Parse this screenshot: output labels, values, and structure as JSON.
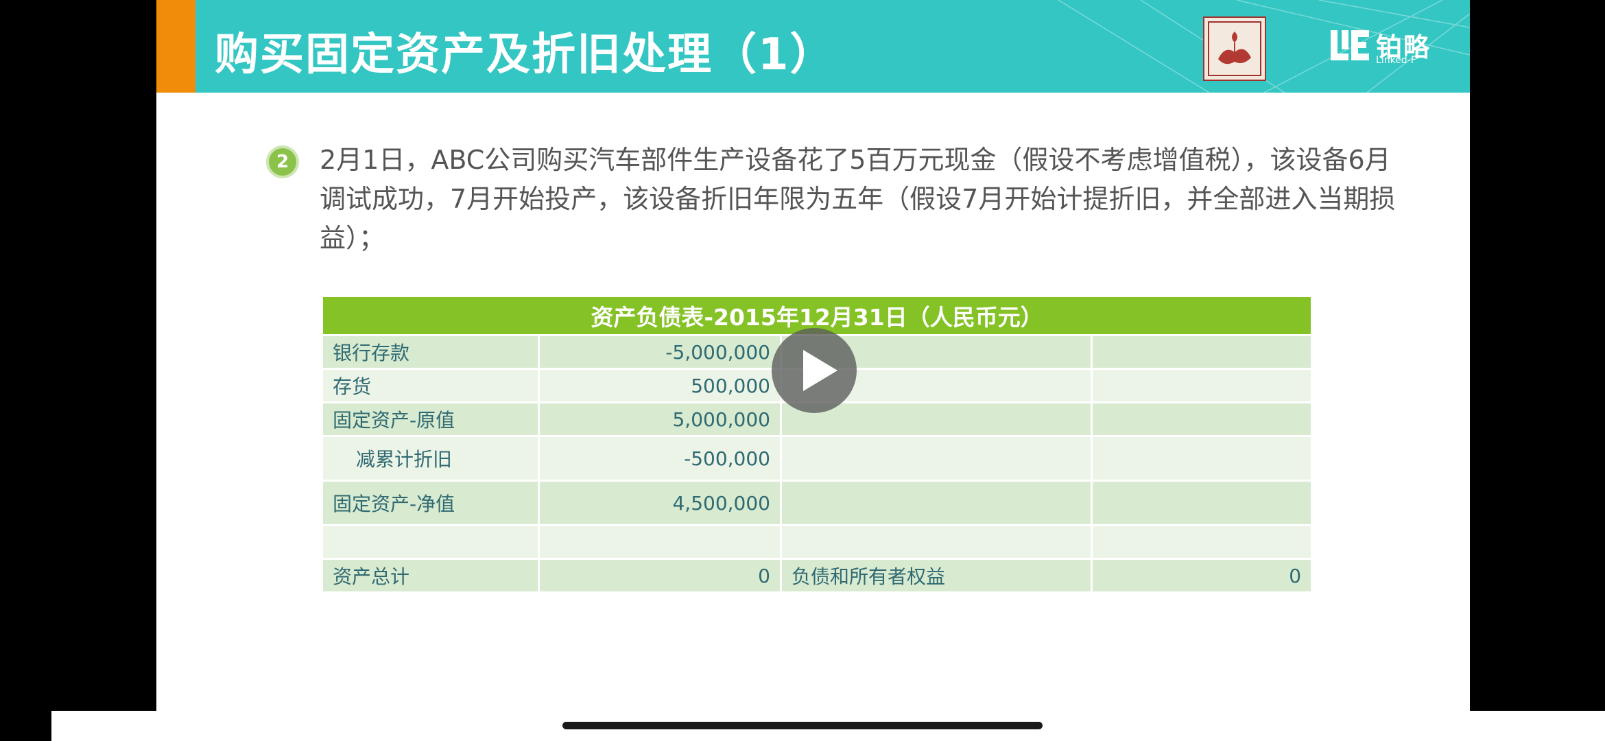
{
  "slide": {
    "title": "购买固定资产及折旧处理（1）",
    "brand_cn": "铂略",
    "brand_en": "Linked-F",
    "bullet_number": "2",
    "paragraph": "2月1日，ABC公司购买汽车部件生产设备花了5百万元现金（假设不考虑增值税），该设备6月调试成功，7月开始投产，该设备折旧年限为五年（假设7月开始计提折旧，并全部进入当期损益）；"
  },
  "table": {
    "title": "资产负债表-2015年12月31日（人民币元）",
    "rows": [
      {
        "label": "银行存款",
        "value": "-5,000,000",
        "label2": "",
        "value2": ""
      },
      {
        "label": "存货",
        "value": "500,000",
        "label2": "",
        "value2": ""
      },
      {
        "label": "固定资产-原值",
        "value": "5,000,000",
        "label2": "",
        "value2": ""
      },
      {
        "label": "减累计折旧",
        "value": "-500,000",
        "label2": "",
        "value2": ""
      },
      {
        "label": "固定资产-净值",
        "value": "4,500,000",
        "label2": "",
        "value2": ""
      },
      {
        "label": "",
        "value": "",
        "label2": "",
        "value2": ""
      },
      {
        "label": "资产总计",
        "value": "0",
        "label2": "负债和所有者权益",
        "value2": "0"
      }
    ]
  },
  "colors": {
    "header_teal": "#33c6c3",
    "header_orange": "#f08c0a",
    "table_header_green": "#84c225",
    "row_dark": "#d8eacf",
    "row_light": "#ecf4e7",
    "cell_text": "#2f6a73"
  },
  "icons": {
    "play": "play-icon",
    "stamp": "stamp-logo-icon",
    "brand": "brand-logo-icon"
  }
}
